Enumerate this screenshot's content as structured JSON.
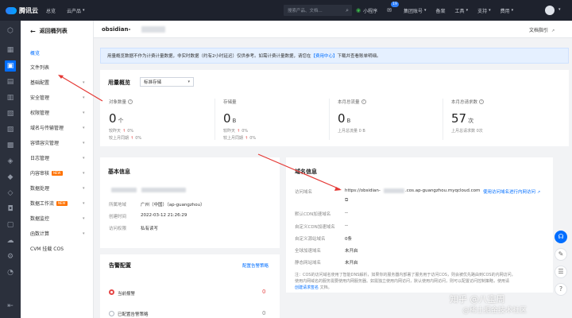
{
  "topbar": {
    "brand": "腾讯云",
    "nav": [
      {
        "label": "总览"
      },
      {
        "label": "云产品"
      }
    ],
    "search_placeholder": "搜索产品、文档...",
    "items": [
      {
        "label": "小程序",
        "icon": "wechat-icon"
      },
      {
        "label": "",
        "icon": "mail-icon",
        "badge": "19"
      },
      {
        "label": "集团账号"
      },
      {
        "label": "备案"
      },
      {
        "label": "工具"
      },
      {
        "label": "支持"
      },
      {
        "label": "费用"
      }
    ]
  },
  "sidebar": {
    "back_label": "返回桶列表",
    "items": [
      {
        "label": "概览",
        "active": true
      },
      {
        "label": "文件列表"
      },
      {
        "label": "基础配置",
        "expandable": true
      },
      {
        "label": "安全管理",
        "expandable": true
      },
      {
        "label": "权限管理",
        "expandable": true
      },
      {
        "label": "域名与传输管理",
        "expandable": true
      },
      {
        "label": "容错容灾管理",
        "expandable": true
      },
      {
        "label": "日志管理",
        "expandable": true
      },
      {
        "label": "内容审核",
        "tag": "NEW",
        "expandable": true
      },
      {
        "label": "数据处理",
        "expandable": true
      },
      {
        "label": "数据工作流",
        "tag": "NEW",
        "expandable": true
      },
      {
        "label": "数据监控",
        "expandable": true
      },
      {
        "label": "函数计算",
        "expandable": true
      },
      {
        "label": "CVM 挂载 COS"
      }
    ]
  },
  "header": {
    "bucket_prefix": "obsidian-",
    "doc_guide": "文档指引"
  },
  "notice": {
    "text": "用量概览数据不作为计费计量数据，非实时数据（约有2小时延迟）仅供参考。如需计费计量数据，请您在",
    "link": "【费用中心】",
    "suffix": "下载并查看账单明细。"
  },
  "usage": {
    "title": "用量概览",
    "storage_class": "标准存储",
    "metrics": [
      {
        "label": "对象数量",
        "value": "0",
        "unit": "个",
        "sub1_label": "较昨天",
        "sub1_value": "0%",
        "sub2_label": "较上月同期",
        "sub2_value": "0%"
      },
      {
        "label": "存储量",
        "value": "0",
        "unit": "B",
        "sub1_label": "较昨天",
        "sub1_value": "0%",
        "sub2_label": "较上月同期",
        "sub2_value": "0%"
      },
      {
        "label": "本月总流量",
        "value": "0",
        "unit": "B",
        "sub1_label": "上月总流量 0 B"
      },
      {
        "label": "本月总请求数",
        "value": "57",
        "unit": "次",
        "sub1_label": "上月总请求数 0次"
      }
    ]
  },
  "basic_info": {
    "title": "基本信息",
    "rows": [
      {
        "label": "所属地域",
        "value": "广州（中国）（ap-guangzhou）"
      },
      {
        "label": "创建时间",
        "value": "2022-03-12 21:26:29"
      },
      {
        "label": "访问权限",
        "value": "私有读写"
      }
    ]
  },
  "domain_info": {
    "title": "域名信息",
    "rows": [
      {
        "label": "访问域名",
        "value": "https://obsidian-",
        "value_suffix": ".cos.ap-guangzhou.myqcloud.com"
      },
      {
        "label": "默认CDN加速域名",
        "value": "--"
      },
      {
        "label": "自定义CDN加速域名",
        "value": "--"
      },
      {
        "label": "自定义源站域名",
        "value": "0条"
      },
      {
        "label": "全球加速域名",
        "value": "未开启"
      },
      {
        "label": "静态网站域名",
        "value": "未开启"
      }
    ],
    "internal_link": "使用访问域名进行内网访问",
    "tip_line1": "注：COS的访问域名使用了智能DNS解析，如果你的服务器内部署了服务用于访问COS，则会被优先路由到COS的内网访问，",
    "tip_line2": "使用内网域名的服务需要使用内网服务器。如需独立使用内网访问，默认使用内网访问，则可以配置访问控制策略，使用请",
    "tip_link": "创建请求签名",
    "tip_suffix": "文档。"
  },
  "alarm": {
    "title": "告警配置",
    "config_link": "配置告警策略",
    "rows": [
      {
        "label": "当前报警",
        "count": "0"
      },
      {
        "label": "已配置告警策略",
        "count": "0"
      }
    ]
  },
  "watermark": {
    "line1": "知乎 @八宝周",
    "line2": "@稀土掘金技术社区"
  },
  "colors": {
    "accent": "#006eff",
    "topbar": "#1e222d",
    "rail": "#2b303c",
    "danger": "#e54545"
  }
}
